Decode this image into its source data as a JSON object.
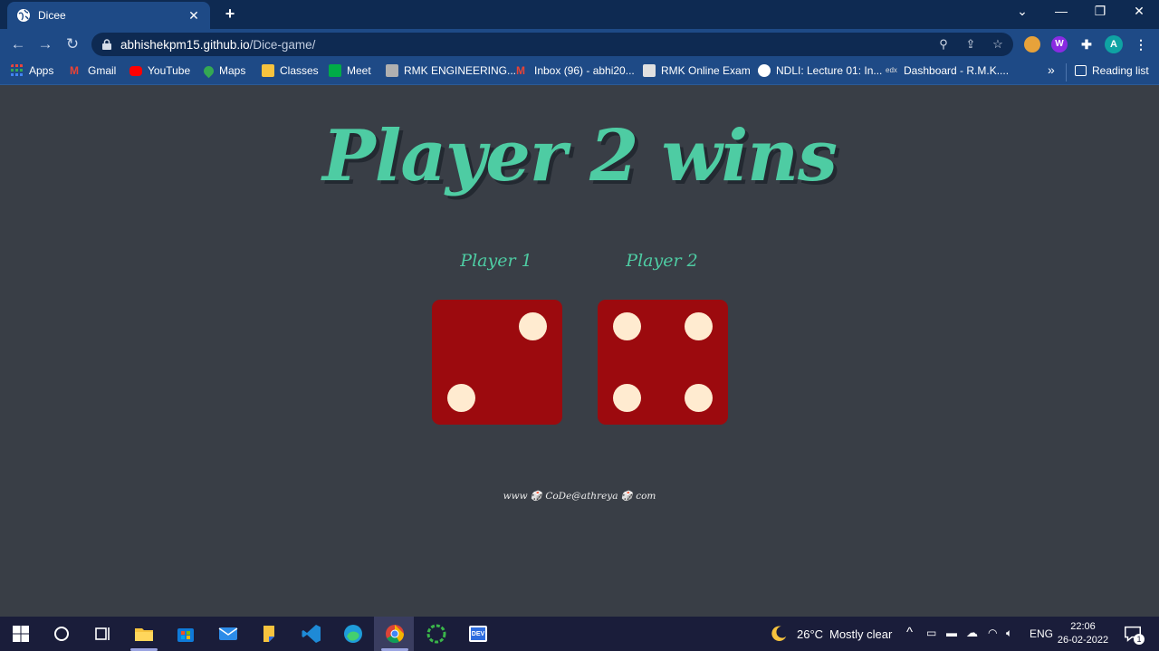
{
  "browser": {
    "tab_title": "Dicee",
    "new_tab_symbol": "+",
    "url_host": "abhishekpm15.github.io",
    "url_path": "/Dice-game/",
    "profile_initial": "A",
    "window_controls": {
      "tab_search": "⌄",
      "minimize": "—",
      "restore": "❐",
      "close": "✕"
    }
  },
  "bookmarks": [
    {
      "label": "Apps",
      "icon": "apps-grid-icon",
      "color": "#E8453C"
    },
    {
      "label": "Gmail",
      "icon": "gmail-icon",
      "color": "#EA4335"
    },
    {
      "label": "YouTube",
      "icon": "youtube-icon",
      "color": "#FF0000"
    },
    {
      "label": "Maps",
      "icon": "maps-icon",
      "color": "#34A853"
    },
    {
      "label": "Classes",
      "icon": "classroom-icon",
      "color": "#F7C33E"
    },
    {
      "label": "Meet",
      "icon": "meet-icon",
      "color": "#00AC47"
    },
    {
      "label": "RMK ENGINEERING...",
      "icon": "rmk-icon",
      "color": "#B0B0B0"
    },
    {
      "label": "Inbox (96) - abhi20...",
      "icon": "gmail-icon",
      "color": "#EA4335"
    },
    {
      "label": "RMK Online Exam",
      "icon": "rmk-exam-icon",
      "color": "#E0E0E0"
    },
    {
      "label": "NDLI: Lecture 01: In...",
      "icon": "globe-icon",
      "color": "#FFFFFF"
    },
    {
      "label": "Dashboard - R.M.K....",
      "icon": "edx-icon",
      "color": "#D0D0D0"
    }
  ],
  "bookmarks_overflow": "»",
  "reading_list": "Reading list",
  "page": {
    "headline": "Player 2 wins",
    "player1_label": "Player 1",
    "player2_label": "Player 2",
    "player1_die_value": 2,
    "player2_die_value": 4,
    "footer": "www 🎲 CoDe@athreya 🎲 com"
  },
  "taskbar": {
    "weather_temp": "26°C",
    "weather_desc": "Mostly clear",
    "language": "ENG",
    "time": "22:06",
    "date": "26-02-2022",
    "notification_count": "1"
  },
  "colors": {
    "page_bg": "#393E46",
    "accent": "#4ECCA3",
    "die": "#9C0A0E",
    "pip": "#FFEBD0",
    "chrome_dark": "#0E2A52",
    "chrome_light": "#1E4A86"
  }
}
